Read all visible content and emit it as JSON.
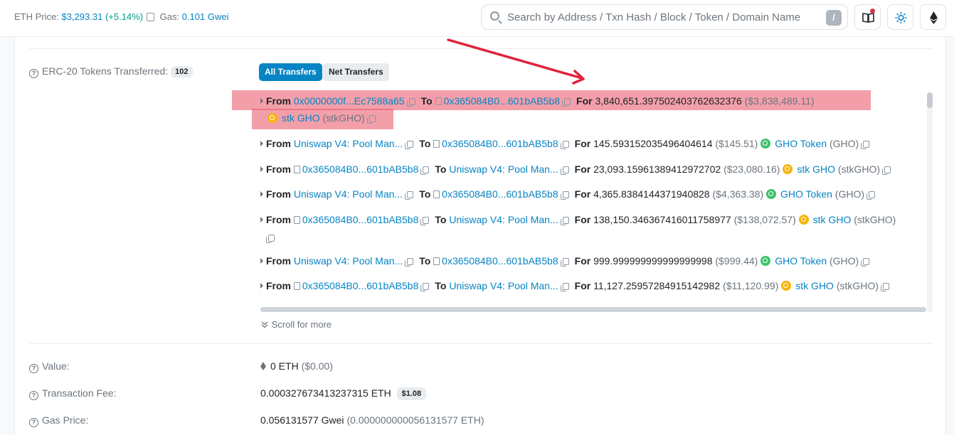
{
  "header": {
    "eth_price_label": "ETH Price:",
    "eth_price_value": "$3,293.31",
    "eth_price_change": "(+5.14%)",
    "gas_label": "Gas:",
    "gas_value": "0.101 Gwei",
    "search_placeholder": "Search by Address / Txn Hash / Block / Token / Domain Name",
    "search_shortcut": "/"
  },
  "erc20": {
    "label": "ERC-20 Tokens Transferred:",
    "count": "102",
    "tab_all": "All Transfers",
    "tab_net": "Net Transfers",
    "transfers": [
      {
        "from": "0x0000000f...Ec7588a65",
        "to": "0x365084B0...601bAB5b8",
        "amount": "3,840,651.397502403762632376",
        "usd": "($3,838,489.11)",
        "token": "stk GHO",
        "symbol": "(stkGHO)",
        "icon": "stk"
      },
      {
        "from": "Uniswap V4: Pool Man...",
        "to": "0x365084B0...601bAB5b8",
        "amount": "145.593152035496404614",
        "usd": "($145.51)",
        "token": "GHO Token",
        "symbol": "(GHO)",
        "icon": "gho"
      },
      {
        "from": "0x365084B0...601bAB5b8",
        "to": "Uniswap V4: Pool Man...",
        "amount": "23,093.15961389412972702",
        "usd": "($23,080.16)",
        "token": "stk GHO",
        "symbol": "(stkGHO)",
        "icon": "stk"
      },
      {
        "from": "Uniswap V4: Pool Man...",
        "to": "0x365084B0...601bAB5b8",
        "amount": "4,365.8384144371940828",
        "usd": "($4,363.38)",
        "token": "GHO Token",
        "symbol": "(GHO)",
        "icon": "gho"
      },
      {
        "from": "0x365084B0...601bAB5b8",
        "to": "Uniswap V4: Pool Man...",
        "amount": "138,150.346367416011758977",
        "usd": "($138,072.57)",
        "token": "stk GHO",
        "symbol": "(stkGHO)",
        "icon": "stk"
      },
      {
        "from": "Uniswap V4: Pool Man...",
        "to": "0x365084B0...601bAB5b8",
        "amount": "999.999999999999999998",
        "usd": "($999.44)",
        "token": "GHO Token",
        "symbol": "(GHO)",
        "icon": "gho"
      },
      {
        "from": "0x365084B0...601bAB5b8",
        "to": "Uniswap V4: Pool Man...",
        "amount": "11,127.25957284915142982",
        "usd": "($11,120.99)",
        "token": "stk GHO",
        "symbol": "(stkGHO)",
        "icon": "stk"
      }
    ],
    "word_from": "From",
    "word_to": "To",
    "word_for": "For",
    "scroll_more": "Scroll for more"
  },
  "value": {
    "label": "Value:",
    "amount": "0 ETH",
    "usd": "($0.00)"
  },
  "fee": {
    "label": "Transaction Fee:",
    "amount": "0.000327673413237315 ETH",
    "usd": "$1.08"
  },
  "gas_price": {
    "label": "Gas Price:",
    "amount": "0.056131577 Gwei",
    "eth": "(0.000000000056131577 ETH)"
  },
  "colors": {
    "link": "#0784c3",
    "highlight": "#e85064",
    "arrow": "#e0223a",
    "primary": "#0784c3"
  }
}
